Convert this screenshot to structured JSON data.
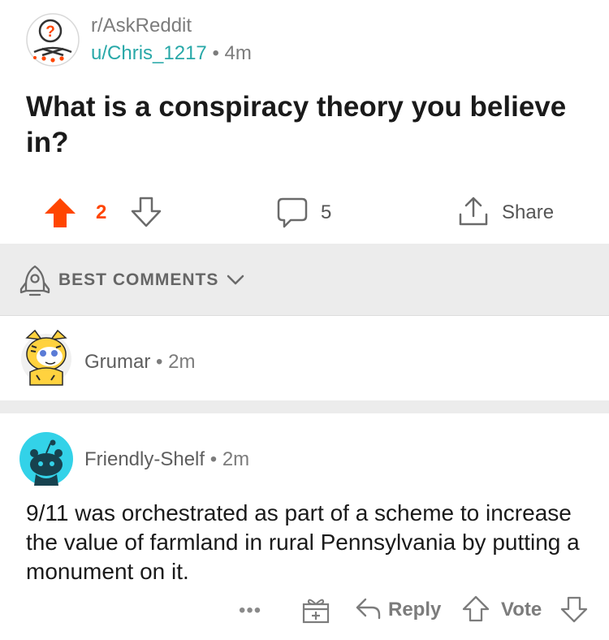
{
  "post": {
    "subreddit": "r/AskReddit",
    "author": "u/Chris_1217",
    "age": "4m",
    "title": "What is a conspiracy theory you believe in?",
    "vote_count": "2",
    "comment_count": "5",
    "share_label": "Share"
  },
  "sort": {
    "label": "BEST COMMENTS"
  },
  "comments": [
    {
      "author": "Grumar",
      "age": "2m"
    },
    {
      "author": "Friendly-Shelf",
      "age": "2m",
      "body": "9/11 was orchestrated as part of a scheme to increase the value of farmland in rural Pennsylvania by putting a monument on it.",
      "actions": {
        "more": "•••",
        "reply_label": "Reply",
        "vote_label": "Vote"
      }
    }
  ],
  "separator": "•",
  "colors": {
    "upvote": "#ff4500",
    "username": "#28a8a8",
    "muted": "#7c7c7c",
    "sort_bar": "#ececec"
  },
  "icons": [
    "subreddit-askreddit-icon",
    "upvote-icon",
    "downvote-icon",
    "comment-icon",
    "share-icon",
    "sort-rocket-icon",
    "chevron-down-icon",
    "award-icon",
    "reply-icon"
  ]
}
